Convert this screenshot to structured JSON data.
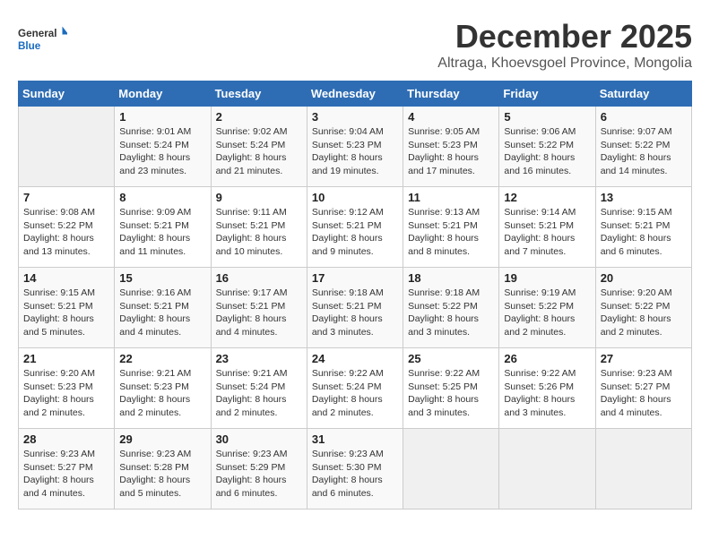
{
  "header": {
    "logo_general": "General",
    "logo_blue": "Blue",
    "month": "December 2025",
    "location": "Altraga, Khoevsgoel Province, Mongolia"
  },
  "days_of_week": [
    "Sunday",
    "Monday",
    "Tuesday",
    "Wednesday",
    "Thursday",
    "Friday",
    "Saturday"
  ],
  "weeks": [
    [
      {
        "day": "",
        "sunrise": "",
        "sunset": "",
        "daylight": ""
      },
      {
        "day": "1",
        "sunrise": "Sunrise: 9:01 AM",
        "sunset": "Sunset: 5:24 PM",
        "daylight": "Daylight: 8 hours and 23 minutes."
      },
      {
        "day": "2",
        "sunrise": "Sunrise: 9:02 AM",
        "sunset": "Sunset: 5:24 PM",
        "daylight": "Daylight: 8 hours and 21 minutes."
      },
      {
        "day": "3",
        "sunrise": "Sunrise: 9:04 AM",
        "sunset": "Sunset: 5:23 PM",
        "daylight": "Daylight: 8 hours and 19 minutes."
      },
      {
        "day": "4",
        "sunrise": "Sunrise: 9:05 AM",
        "sunset": "Sunset: 5:23 PM",
        "daylight": "Daylight: 8 hours and 17 minutes."
      },
      {
        "day": "5",
        "sunrise": "Sunrise: 9:06 AM",
        "sunset": "Sunset: 5:22 PM",
        "daylight": "Daylight: 8 hours and 16 minutes."
      },
      {
        "day": "6",
        "sunrise": "Sunrise: 9:07 AM",
        "sunset": "Sunset: 5:22 PM",
        "daylight": "Daylight: 8 hours and 14 minutes."
      }
    ],
    [
      {
        "day": "7",
        "sunrise": "Sunrise: 9:08 AM",
        "sunset": "Sunset: 5:22 PM",
        "daylight": "Daylight: 8 hours and 13 minutes."
      },
      {
        "day": "8",
        "sunrise": "Sunrise: 9:09 AM",
        "sunset": "Sunset: 5:21 PM",
        "daylight": "Daylight: 8 hours and 11 minutes."
      },
      {
        "day": "9",
        "sunrise": "Sunrise: 9:11 AM",
        "sunset": "Sunset: 5:21 PM",
        "daylight": "Daylight: 8 hours and 10 minutes."
      },
      {
        "day": "10",
        "sunrise": "Sunrise: 9:12 AM",
        "sunset": "Sunset: 5:21 PM",
        "daylight": "Daylight: 8 hours and 9 minutes."
      },
      {
        "day": "11",
        "sunrise": "Sunrise: 9:13 AM",
        "sunset": "Sunset: 5:21 PM",
        "daylight": "Daylight: 8 hours and 8 minutes."
      },
      {
        "day": "12",
        "sunrise": "Sunrise: 9:14 AM",
        "sunset": "Sunset: 5:21 PM",
        "daylight": "Daylight: 8 hours and 7 minutes."
      },
      {
        "day": "13",
        "sunrise": "Sunrise: 9:15 AM",
        "sunset": "Sunset: 5:21 PM",
        "daylight": "Daylight: 8 hours and 6 minutes."
      }
    ],
    [
      {
        "day": "14",
        "sunrise": "Sunrise: 9:15 AM",
        "sunset": "Sunset: 5:21 PM",
        "daylight": "Daylight: 8 hours and 5 minutes."
      },
      {
        "day": "15",
        "sunrise": "Sunrise: 9:16 AM",
        "sunset": "Sunset: 5:21 PM",
        "daylight": "Daylight: 8 hours and 4 minutes."
      },
      {
        "day": "16",
        "sunrise": "Sunrise: 9:17 AM",
        "sunset": "Sunset: 5:21 PM",
        "daylight": "Daylight: 8 hours and 4 minutes."
      },
      {
        "day": "17",
        "sunrise": "Sunrise: 9:18 AM",
        "sunset": "Sunset: 5:21 PM",
        "daylight": "Daylight: 8 hours and 3 minutes."
      },
      {
        "day": "18",
        "sunrise": "Sunrise: 9:18 AM",
        "sunset": "Sunset: 5:22 PM",
        "daylight": "Daylight: 8 hours and 3 minutes."
      },
      {
        "day": "19",
        "sunrise": "Sunrise: 9:19 AM",
        "sunset": "Sunset: 5:22 PM",
        "daylight": "Daylight: 8 hours and 2 minutes."
      },
      {
        "day": "20",
        "sunrise": "Sunrise: 9:20 AM",
        "sunset": "Sunset: 5:22 PM",
        "daylight": "Daylight: 8 hours and 2 minutes."
      }
    ],
    [
      {
        "day": "21",
        "sunrise": "Sunrise: 9:20 AM",
        "sunset": "Sunset: 5:23 PM",
        "daylight": "Daylight: 8 hours and 2 minutes."
      },
      {
        "day": "22",
        "sunrise": "Sunrise: 9:21 AM",
        "sunset": "Sunset: 5:23 PM",
        "daylight": "Daylight: 8 hours and 2 minutes."
      },
      {
        "day": "23",
        "sunrise": "Sunrise: 9:21 AM",
        "sunset": "Sunset: 5:24 PM",
        "daylight": "Daylight: 8 hours and 2 minutes."
      },
      {
        "day": "24",
        "sunrise": "Sunrise: 9:22 AM",
        "sunset": "Sunset: 5:24 PM",
        "daylight": "Daylight: 8 hours and 2 minutes."
      },
      {
        "day": "25",
        "sunrise": "Sunrise: 9:22 AM",
        "sunset": "Sunset: 5:25 PM",
        "daylight": "Daylight: 8 hours and 3 minutes."
      },
      {
        "day": "26",
        "sunrise": "Sunrise: 9:22 AM",
        "sunset": "Sunset: 5:26 PM",
        "daylight": "Daylight: 8 hours and 3 minutes."
      },
      {
        "day": "27",
        "sunrise": "Sunrise: 9:23 AM",
        "sunset": "Sunset: 5:27 PM",
        "daylight": "Daylight: 8 hours and 4 minutes."
      }
    ],
    [
      {
        "day": "28",
        "sunrise": "Sunrise: 9:23 AM",
        "sunset": "Sunset: 5:27 PM",
        "daylight": "Daylight: 8 hours and 4 minutes."
      },
      {
        "day": "29",
        "sunrise": "Sunrise: 9:23 AM",
        "sunset": "Sunset: 5:28 PM",
        "daylight": "Daylight: 8 hours and 5 minutes."
      },
      {
        "day": "30",
        "sunrise": "Sunrise: 9:23 AM",
        "sunset": "Sunset: 5:29 PM",
        "daylight": "Daylight: 8 hours and 6 minutes."
      },
      {
        "day": "31",
        "sunrise": "Sunrise: 9:23 AM",
        "sunset": "Sunset: 5:30 PM",
        "daylight": "Daylight: 8 hours and 6 minutes."
      },
      {
        "day": "",
        "sunrise": "",
        "sunset": "",
        "daylight": ""
      },
      {
        "day": "",
        "sunrise": "",
        "sunset": "",
        "daylight": ""
      },
      {
        "day": "",
        "sunrise": "",
        "sunset": "",
        "daylight": ""
      }
    ]
  ]
}
